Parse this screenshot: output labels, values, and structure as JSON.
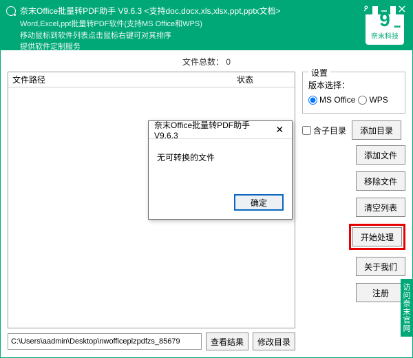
{
  "titlebar": {
    "line1": "奈末Office批量转PDF助手    V9.6.3  <支持doc,docx,xls,xlsx,ppt,pptx文档>",
    "line2": "Word,Excel,ppt批量转PDF软件(支持MS Office和WPS)",
    "line3": "移动鼠标到软件列表点击鼠标右键可对其排序",
    "line4": "提供软件定制服务",
    "logo_label": "奈末科技"
  },
  "total": {
    "label": "文件总数：",
    "value": "0"
  },
  "list": {
    "col_path": "文件路径",
    "col_status": "状态"
  },
  "path": {
    "value": "C:\\Users\\aadmin\\Desktop\\nwofficeplzpdfzs_85679",
    "view_result": "查看结果",
    "modify_dir": "修改目录"
  },
  "settings": {
    "legend": "设置",
    "version_label": "版本选择：",
    "ms_office": "MS Office",
    "wps": "WPS"
  },
  "options": {
    "include_subdir": "含子目录"
  },
  "buttons": {
    "add_dir": "添加目录",
    "add_file": "添加文件",
    "remove_file": "移除文件",
    "clear_list": "清空列表",
    "start": "开始处理",
    "about": "关于我们",
    "register": "注册"
  },
  "side_tab": "访问奈末官网",
  "dialog": {
    "title": "奈末Office批量转PDF助手V9.6.3",
    "message": "无可转换的文件",
    "ok": "确定"
  }
}
